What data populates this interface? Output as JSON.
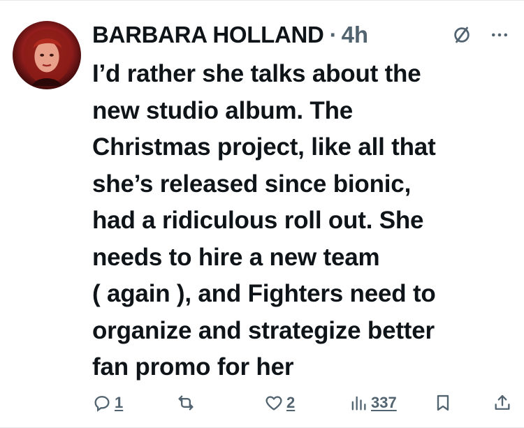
{
  "tweet": {
    "author_name": "BARBARA HOLLAND",
    "separator": "·",
    "time": "4h",
    "text": "I’d rather she talks about the\nnew studio album. The\nChristmas project, like all that\nshe’s released since bionic,\nhad a ridiculous roll out. She\nneeds to hire a new team\n( again ), and Fighters need to\norganize and strategize better\nfan promo for her"
  },
  "actions": {
    "reply_count": "1",
    "like_count": "2",
    "views_count": "337"
  },
  "icons": {
    "grok": "slashed-circle-icon",
    "more": "more-dots-icon",
    "reply": "reply-icon",
    "repost": "repost-icon",
    "like": "heart-icon",
    "views": "views-icon",
    "bookmark": "bookmark-icon",
    "share": "share-icon"
  },
  "colors": {
    "text": "#0f1419",
    "secondary": "#536471",
    "background": "#ffffff"
  }
}
